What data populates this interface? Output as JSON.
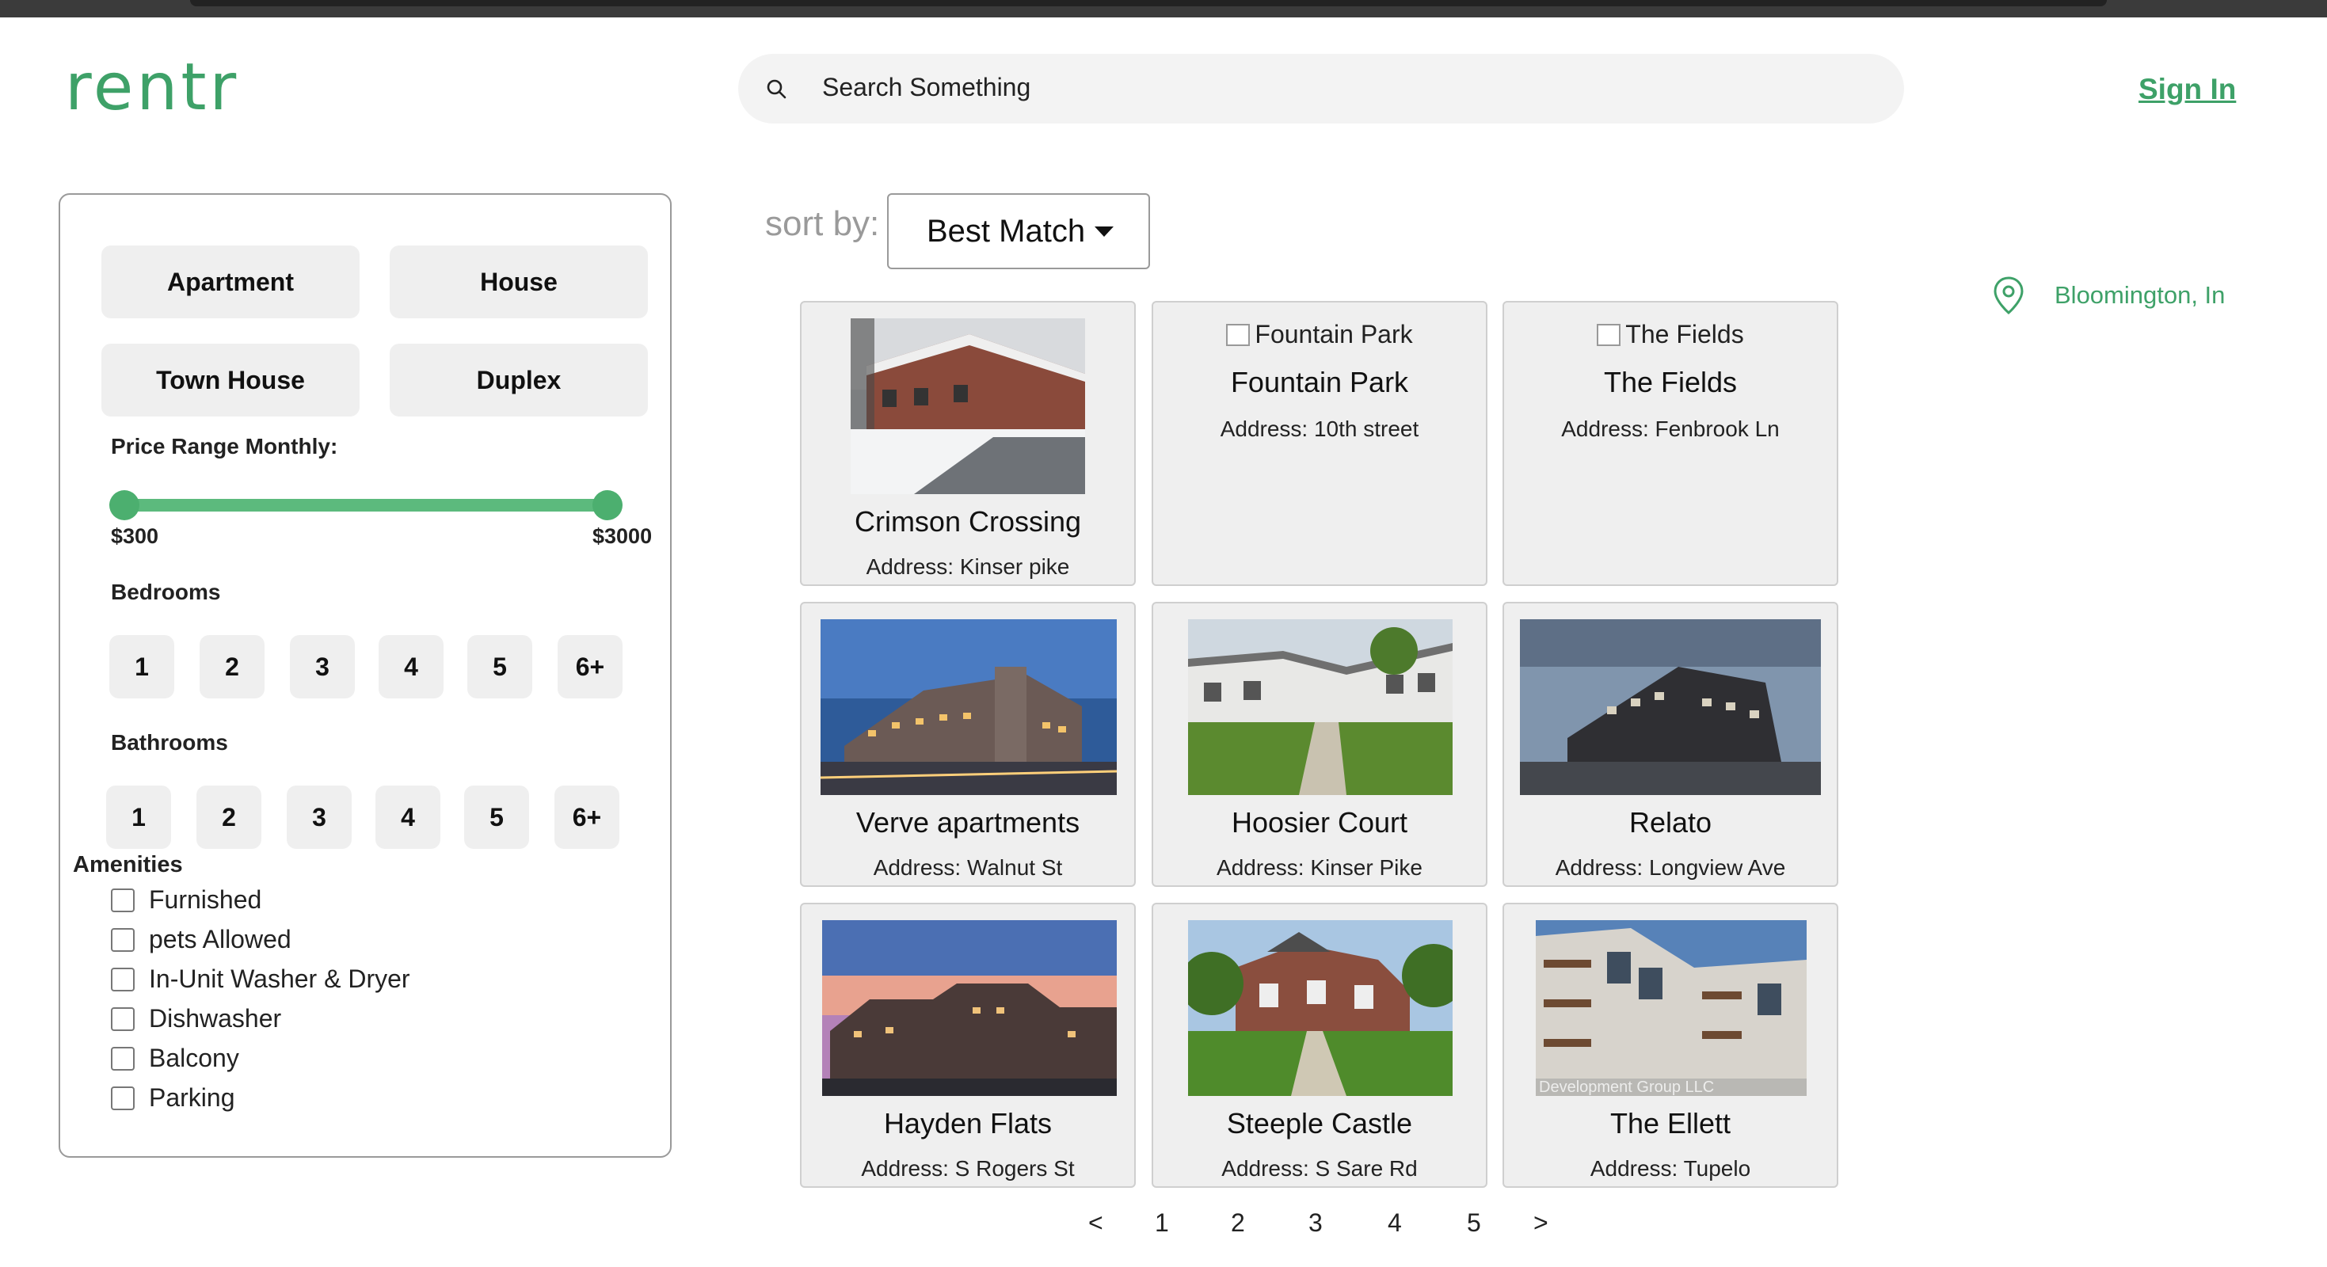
{
  "header": {
    "logo": "rentr",
    "search_placeholder": "Search Something",
    "sign_in": "Sign In"
  },
  "filters": {
    "property_types": [
      "Apartment",
      "House",
      "Town House",
      "Duplex"
    ],
    "price_label": "Price Range Monthly:",
    "price_min": "$300",
    "price_max": "$3000",
    "bedrooms_label": "Bedrooms",
    "bedrooms": [
      "1",
      "2",
      "3",
      "4",
      "5",
      "6+"
    ],
    "bathrooms_label": "Bathrooms",
    "bathrooms": [
      "1",
      "2",
      "3",
      "4",
      "5",
      "6+"
    ],
    "amenities_label": "Amenities",
    "amenities": [
      "Furnished",
      "pets Allowed",
      "In-Unit Washer & Dryer",
      "Dishwasher",
      "Balcony",
      "Parking"
    ]
  },
  "sort": {
    "label": "sort by:",
    "value": "Best Match"
  },
  "location": "Bloomington, In",
  "listings": [
    {
      "name": "Crimson Crossing",
      "address": "Address: Kinser pike",
      "image": "snowy-townhouses"
    },
    {
      "name": "Fountain Park",
      "address": "Address: 10th street",
      "image_alt": "Fountain Park"
    },
    {
      "name": "The Fields",
      "address": "Address: Fenbrook Ln",
      "image_alt": "The Fields"
    },
    {
      "name": "Verve apartments",
      "address": "Address: Walnut St",
      "image": "dusk-apartment-tower"
    },
    {
      "name": "Hoosier Court",
      "address": "Address: Kinser Pike",
      "image": "white-apartments-lawn"
    },
    {
      "name": "Relato",
      "address": "Address: Longview Ave",
      "image": "dark-modern-building"
    },
    {
      "name": "Hayden Flats",
      "address": "Address: S Rogers St",
      "image": "sunset-complex"
    },
    {
      "name": "Steeple Castle",
      "address": "Address: S Sare Rd",
      "image": "brick-apartments-path"
    },
    {
      "name": "The Ellett",
      "address": "Address: Tupelo",
      "image": "modern-balcony-building",
      "image_overlay": "Development Group LLC"
    }
  ],
  "pagination": [
    "<",
    "1",
    "2",
    "3",
    "4",
    "5",
    ">"
  ]
}
